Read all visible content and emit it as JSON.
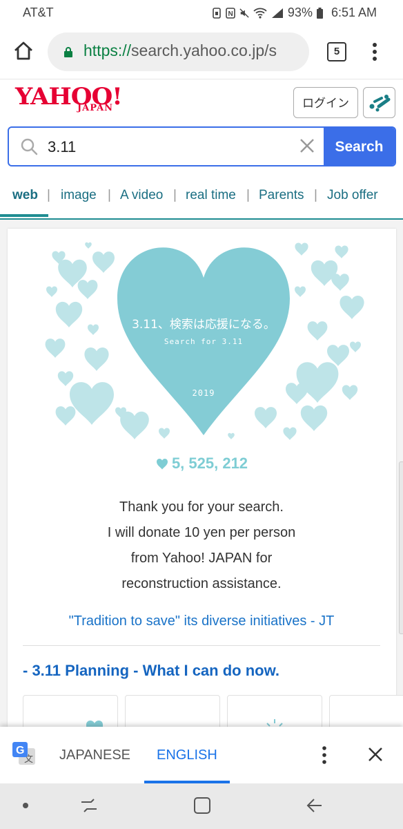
{
  "status_bar": {
    "carrier": "AT&T",
    "battery": "93%",
    "time": "6:51 AM"
  },
  "browser": {
    "url_scheme": "https://",
    "url_rest": "search.yahoo.co.jp/s",
    "tab_count": "5"
  },
  "header": {
    "logo_text": "YAHOO!",
    "logo_sub": "JAPAN",
    "login_label": "ログイン"
  },
  "search": {
    "query": "3.11",
    "button_label": "Search"
  },
  "nav": {
    "tabs": [
      "web",
      "image",
      "A video",
      "real time",
      "Parents",
      "Job offer"
    ]
  },
  "campaign": {
    "heart_title": "3.11、検索は応援になる。",
    "heart_subtitle": "Search for 3.11",
    "heart_year": "2019",
    "counter": "5, 525, 212",
    "message_lines": [
      "Thank you for your search.",
      "I will donate 10 yen per person",
      "from Yahoo! JAPAN for",
      "reconstruction assistance."
    ],
    "link_text": "\"Tradition to save\" its diverse initiatives - JT",
    "planning_title": "- 3.11 Planning - What I can do now."
  },
  "translate": {
    "lang_source": "JAPANESE",
    "lang_target": "ENGLISH"
  },
  "colors": {
    "accent_blue": "#3b6ee8",
    "teal": "#1f8d92",
    "heart": "#84ccd5",
    "link": "#1a73c8"
  }
}
